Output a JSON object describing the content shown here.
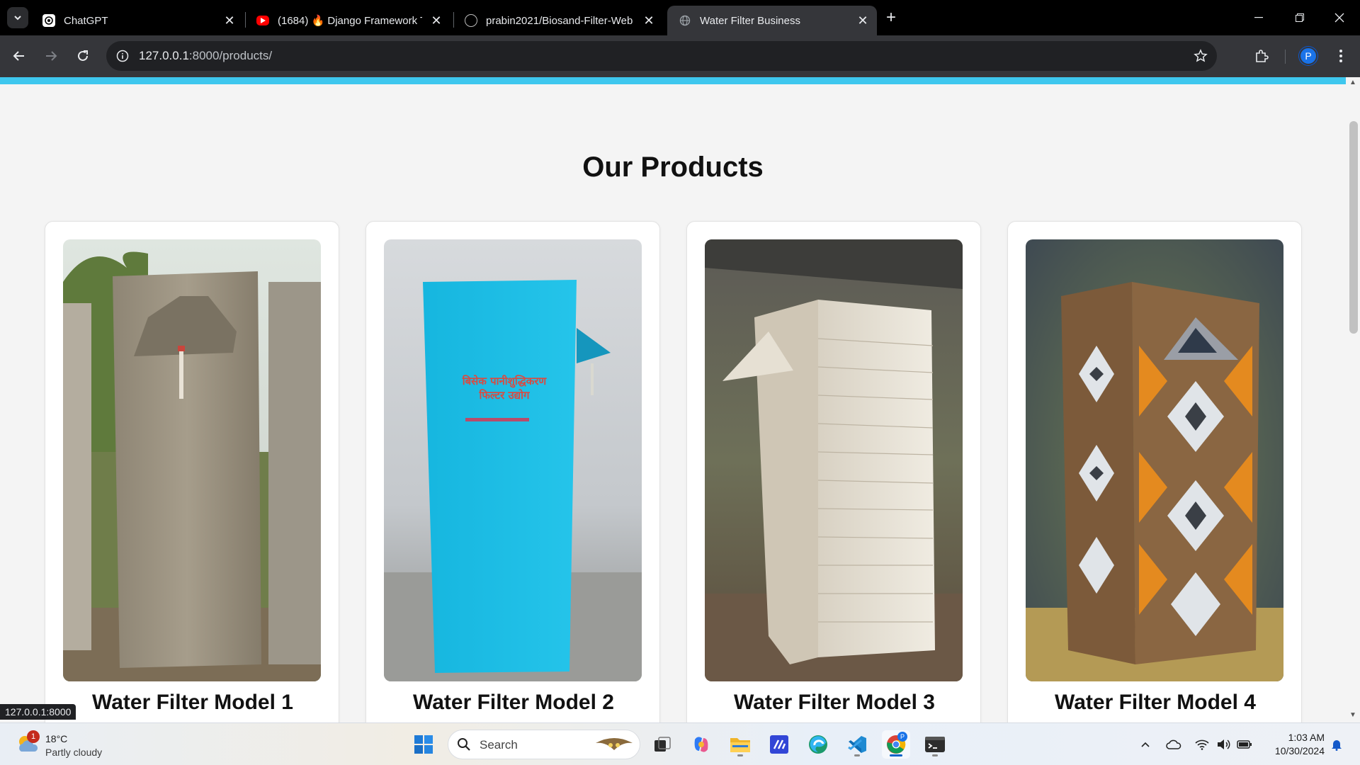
{
  "browser": {
    "tabs": [
      {
        "title": "ChatGPT",
        "favicon": "chatgpt-icon",
        "active": false
      },
      {
        "title": "(1684) 🔥 Django Framework T",
        "favicon": "youtube-icon",
        "active": false
      },
      {
        "title": "prabin2021/Biosand-Filter-Web",
        "favicon": "github-icon",
        "active": false
      },
      {
        "title": "Water Filter Business",
        "favicon": "globe-icon",
        "active": true
      }
    ],
    "url_host": "127.0.0.1",
    "url_path": ":8000/products/",
    "profile_initial": "P",
    "status_url": "127.0.0.1:8000"
  },
  "page": {
    "heading": "Our Products",
    "accent_color": "#3ec7ee",
    "products": [
      {
        "name": "Water Filter Model 1",
        "image": "concrete-filter-photo"
      },
      {
        "name": "Water Filter Model 2",
        "image": "blue-filter-photo"
      },
      {
        "name": "Water Filter Model 3",
        "image": "white-tiled-filter-photo"
      },
      {
        "name": "Water Filter Model 4",
        "image": "patterned-tile-filter-photo"
      }
    ]
  },
  "taskbar": {
    "weather_temp": "18°C",
    "weather_condition": "Partly cloudy",
    "weather_badge": "1",
    "search_placeholder": "Search",
    "time": "1:03 AM",
    "date": "10/30/2024"
  }
}
